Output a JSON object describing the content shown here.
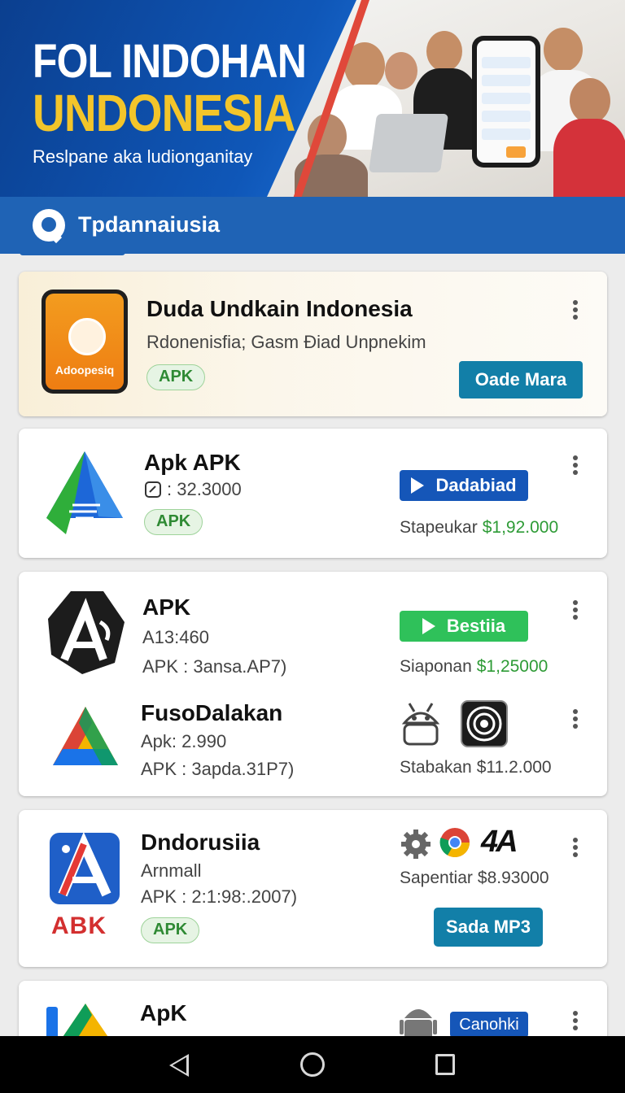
{
  "banner": {
    "title_line1": "FOL INDOHAN",
    "title_line2": "UNDONESIA",
    "subtitle": "Reslpane aka ludionganitay"
  },
  "search": {
    "label": "Tpdannaiusia"
  },
  "featured": {
    "icon_label": "Adoopesiq",
    "title": "Duda Undkain Indonesia",
    "subtitle": "Rdonenisfia; Gasm Ðiad Unpnekim",
    "chip": "APK",
    "button": "Oade Mara"
  },
  "apps": [
    {
      "title": "Apk APK",
      "meta": ": 32.3000",
      "chip": "APK",
      "button": "Dadabiad",
      "price_label": "Stapeukar",
      "price": "$1,92.000"
    },
    {
      "title": "APK",
      "meta": "A13:460",
      "meta2": "APK : 3ansa.AP7)",
      "button": "Bestiia",
      "price_label": "Siaponan",
      "price": "$1,25000"
    },
    {
      "title": "FusoDalakan",
      "meta": "Apk: 2.990",
      "meta2": "APK : 3apda.31P7)",
      "price_label": "Stabakan",
      "price": "$11.2.000"
    },
    {
      "title": "Dndorusiia",
      "meta": "Arnmall",
      "meta2": "APK : 2:1:98:.2007)",
      "icon_text": "ABK",
      "chip": "APK",
      "price_label": "Sapentiar",
      "price": "$8.93000",
      "button": "Sada MP3",
      "brand_text": "4A"
    },
    {
      "title": "ApK",
      "button": "Canohki"
    }
  ],
  "colors": {
    "brand_blue": "#1f63b5",
    "banner_yellow": "#f3c52a",
    "price_green": "#2e9b36",
    "btn_teal": "#127fa8",
    "btn_blue": "#1556b8",
    "btn_green": "#2fc15a"
  }
}
